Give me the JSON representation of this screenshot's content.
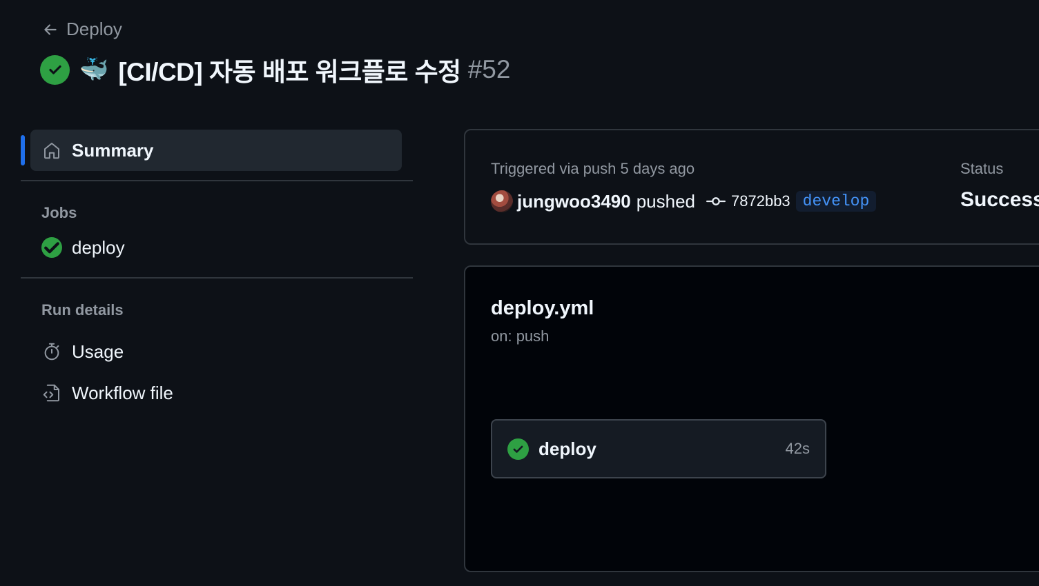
{
  "header": {
    "back_label": "Deploy",
    "emoji": "🐳",
    "run_title": "[CI/CD] 자동 배포 워크플로 수정",
    "run_number": "#52",
    "status_color": "#2ea043"
  },
  "sidebar": {
    "summary_label": "Summary",
    "jobs_heading": "Jobs",
    "jobs": [
      {
        "label": "deploy",
        "status_icon": "check-circle-icon"
      }
    ],
    "run_details_heading": "Run details",
    "run_details": [
      {
        "label": "Usage",
        "icon": "stopwatch-icon"
      },
      {
        "label": "Workflow file",
        "icon": "file-code-icon"
      }
    ],
    "active_color": "#1f6feb"
  },
  "trigger_card": {
    "triggered_text": "Triggered via push 5 days ago",
    "user": "jungwoo3490",
    "action": "pushed",
    "commit_sha": "7872bb3",
    "branch": "develop",
    "status_label": "Status",
    "status_value": "Success"
  },
  "workflow_card": {
    "file_name": "deploy.yml",
    "trigger": "on: push",
    "job": {
      "name": "deploy",
      "duration": "42s"
    }
  }
}
